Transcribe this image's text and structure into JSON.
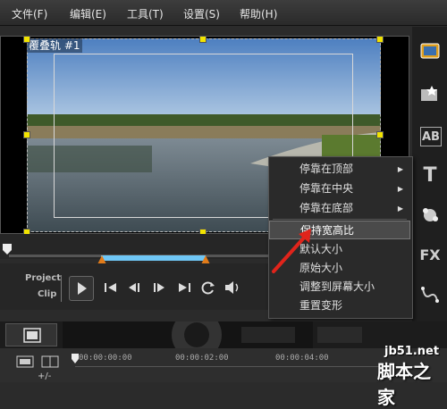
{
  "menu": {
    "file": "文件(F)",
    "edit": "编辑(E)",
    "tools": "工具(T)",
    "settings": "设置(S)",
    "help": "帮助(H)"
  },
  "preview": {
    "overlay_label": "覆叠轨 #1"
  },
  "transport": {
    "project_label": "Project",
    "clip_label": "Clip"
  },
  "context_menu": {
    "items": [
      {
        "label": "停靠在顶部",
        "has_submenu": true
      },
      {
        "label": "停靠在中央",
        "has_submenu": true
      },
      {
        "label": "停靠在底部",
        "has_submenu": true
      },
      {
        "label": "保持宽高比",
        "has_submenu": false,
        "active": true
      },
      {
        "label": "默认大小",
        "has_submenu": false
      },
      {
        "label": "原始大小",
        "has_submenu": false
      },
      {
        "label": "调整到屏幕大小",
        "has_submenu": false
      },
      {
        "label": "重置变形",
        "has_submenu": false
      }
    ]
  },
  "right_toolbar": {
    "icons": [
      "media-icon",
      "effects-icon",
      "ab-transition-icon",
      "title-icon",
      "graphics-icon",
      "fx-filter-icon",
      "path-icon"
    ],
    "ab_text": "AB",
    "title_text": "T",
    "fx_text": "FX"
  },
  "timeline": {
    "time_start": "00:00:00:00",
    "time_mid": "00:00:02:00",
    "time_end": "00:00:04:00",
    "zoom_label": "+/-"
  },
  "watermark": {
    "url": "jb51.net",
    "title": "脚本之家"
  },
  "colors": {
    "handle": "#f2e400",
    "trim_range": "#6fc6f5",
    "trim_marker": "#e07b1a",
    "annotation_arrow": "#e0241b"
  }
}
